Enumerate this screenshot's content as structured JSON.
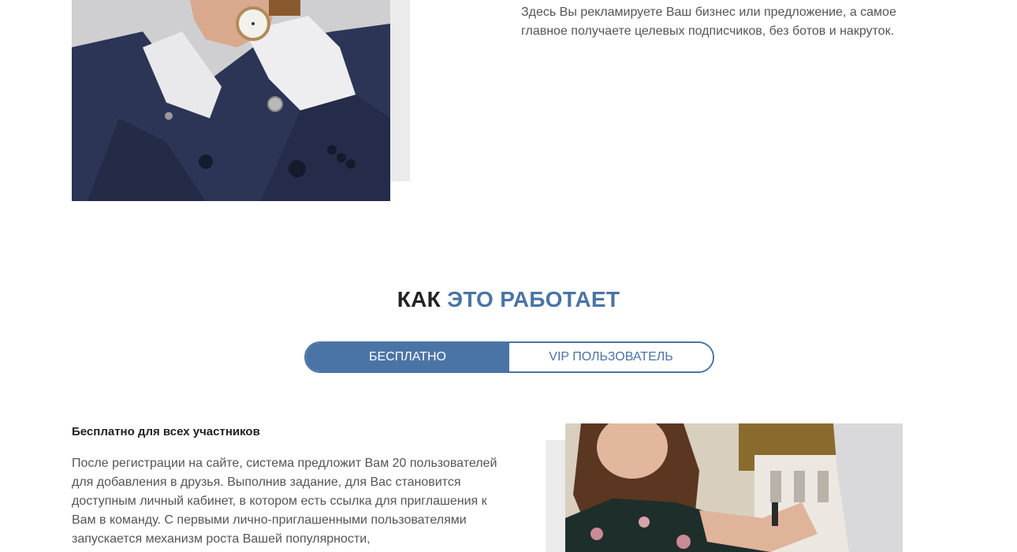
{
  "intro": {
    "text": "Здесь Вы рекламируете Ваш бизнес или предложение, а самое главное получаете целевых подписчиков, без ботов и накруток."
  },
  "how_it_works": {
    "title_part1": "КАК",
    "title_part2": "ЭТО РАБОТАЕТ",
    "tabs": [
      {
        "label": "БЕСПЛАТНО",
        "active": true
      },
      {
        "label": "VIP ПОЛЬЗОВАТЕЛЬ",
        "active": false
      }
    ],
    "subheading": "Бесплатно для всех участников",
    "body": "После регистрации на сайте, система предложит Вам 20 пользователей для добавления в друзья. Выполнив задание, для Вас становится доступным личный кабинет, в котором есть ссылка для приглашения к Вам в команду. С первыми лично-приглашенными пользователями запускается механизм роста Вашей популярности,"
  },
  "colors": {
    "accent": "#4a74a5",
    "title_dark": "#222222",
    "text": "#555555",
    "shadow_block": "#ebebeb"
  }
}
